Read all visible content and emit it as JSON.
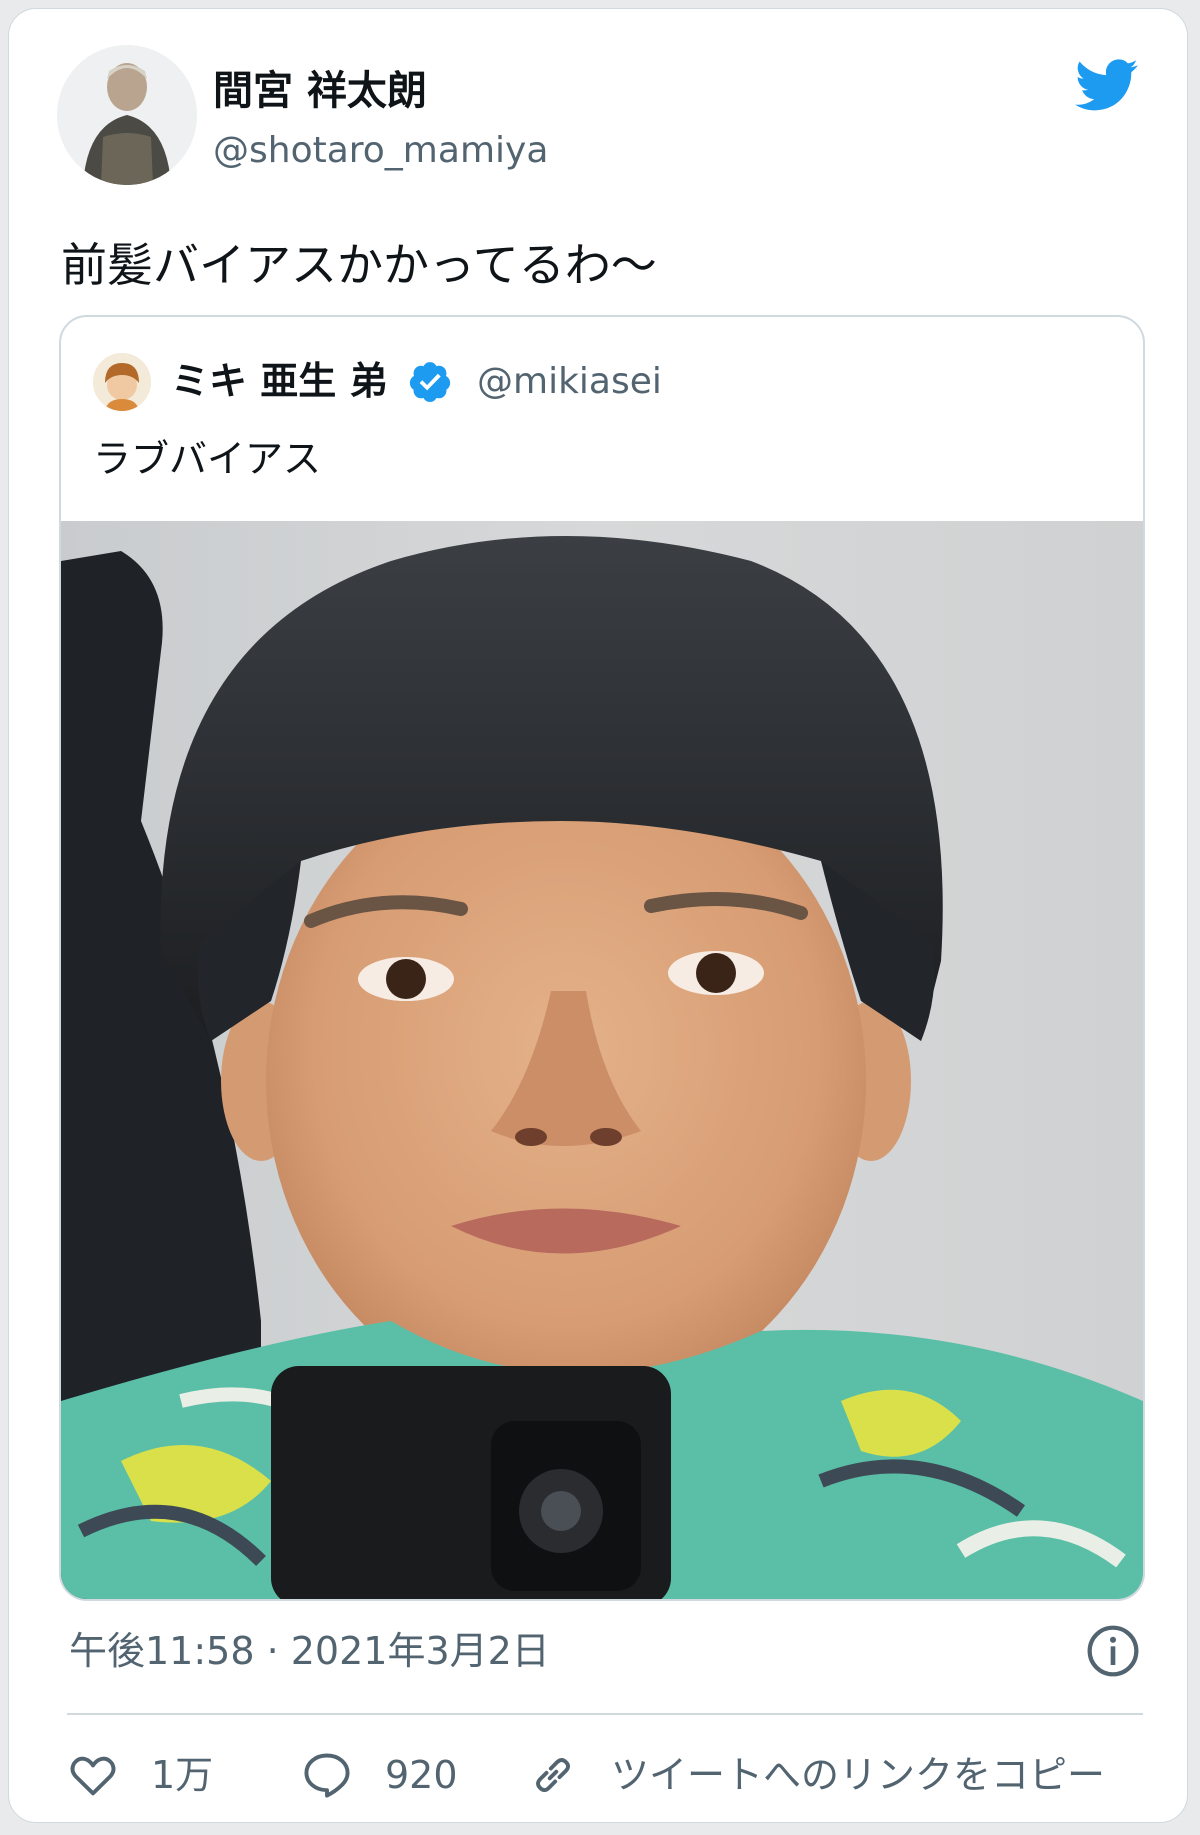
{
  "author": {
    "display_name": "間宮 祥太朗",
    "handle": "@shotaro_mamiya"
  },
  "tweet": {
    "text": "前髪バイアスかかってるわ〜",
    "timestamp": "午後11:58 · 2021年3月2日"
  },
  "quoted_tweet": {
    "display_name": "ミキ 亜生 弟",
    "handle": "@mikiasei",
    "text": "ラブバイアス",
    "verified": true
  },
  "actions": {
    "likes": "1万",
    "replies": "920",
    "copy_link_label": "ツイートへのリンクをコピー"
  },
  "icons": {
    "brand": "twitter-bird-icon",
    "verified": "verified-badge-icon",
    "info": "info-icon",
    "like": "heart-icon",
    "reply": "speech-bubble-icon",
    "link": "link-icon"
  },
  "colors": {
    "brand_blue": "#1d9bf0",
    "secondary_text": "#536471",
    "border": "#cfd9de"
  }
}
